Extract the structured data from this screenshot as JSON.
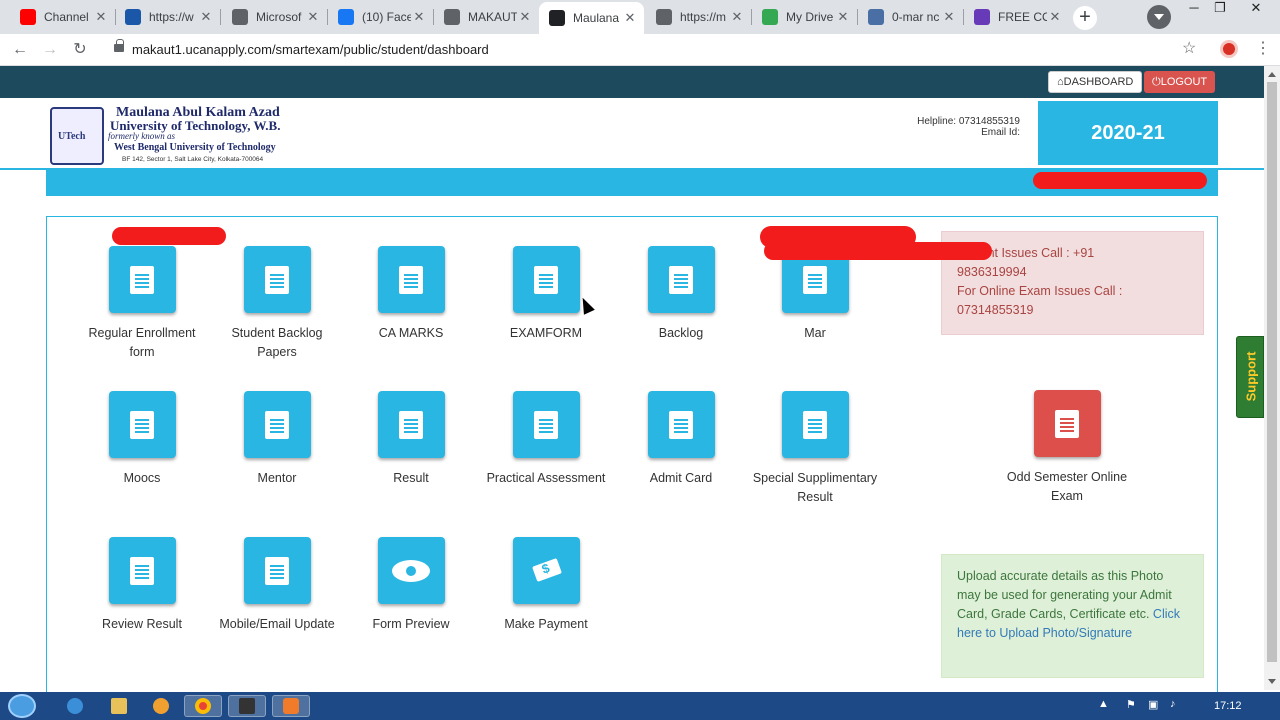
{
  "browser": {
    "tabs": [
      {
        "title": "Channel",
        "favicon": "youtube-icon",
        "color": "#ff0000"
      },
      {
        "title": "https://w",
        "favicon": "nic-icon",
        "color": "#1a57a8"
      },
      {
        "title": "Microsof",
        "favicon": "globe-icon",
        "color": "#5f6368"
      },
      {
        "title": "(10) Face",
        "favicon": "facebook-icon",
        "color": "#1877f2"
      },
      {
        "title": "MAKAUT",
        "favicon": "globe-icon",
        "color": "#5f6368"
      },
      {
        "title": "Maulana",
        "favicon": "graduation-cap-icon",
        "color": "#202124"
      },
      {
        "title": "https://m",
        "favicon": "globe-icon",
        "color": "#5f6368"
      },
      {
        "title": "My Drive",
        "favicon": "google-drive-icon",
        "color": "#34a853"
      },
      {
        "title": "0-mar nc",
        "favicon": "page-icon",
        "color": "#4a6fa5"
      },
      {
        "title": "FREE CO",
        "favicon": "forms-icon",
        "color": "#673ab7"
      }
    ],
    "close_glyph": "✕",
    "new_tab_glyph": "+",
    "url": "makaut1.ucanapply.com/smartexam/public/student/dashboard"
  },
  "page": {
    "dashboard_label": "DASHBOARD",
    "logout_label": "LOGOUT",
    "university": {
      "line1": "Maulana Abul Kalam Azad",
      "line2": "University of Technology, W.B.",
      "line3": "formerly known as",
      "line4": "West Bengal University of Technology",
      "line5": "BF 142, Sector 1, Salt Lake City, Kolkata-700064"
    },
    "helpline": "Helpline: 07314855319",
    "email": "Email Id:",
    "session": "2020-21",
    "tiles_row1": [
      {
        "label": "Regular Enrollment form",
        "icon": "document-icon"
      },
      {
        "label": "Student Backlog Papers",
        "icon": "document-icon"
      },
      {
        "label": "CA MARKS",
        "icon": "document-icon"
      },
      {
        "label": "EXAMFORM",
        "icon": "document-icon"
      },
      {
        "label": "Backlog",
        "icon": "document-icon"
      },
      {
        "label": "Mar",
        "icon": "document-icon"
      }
    ],
    "tiles_row2": [
      {
        "label": "Moocs",
        "icon": "document-icon"
      },
      {
        "label": "Mentor",
        "icon": "document-icon"
      },
      {
        "label": "Result",
        "icon": "document-icon"
      },
      {
        "label": "Practical Assessment",
        "icon": "document-icon"
      },
      {
        "label": "Admit Card",
        "icon": "document-icon"
      },
      {
        "label": "Special Supplimentary Result",
        "icon": "document-icon"
      }
    ],
    "tiles_row3": [
      {
        "label": "Review Result",
        "icon": "document-icon"
      },
      {
        "label": "Mobile/Email Update",
        "icon": "document-icon"
      },
      {
        "label": "Form Preview",
        "icon": "eye-icon"
      },
      {
        "label": "Make Payment",
        "icon": "payment-icon"
      }
    ],
    "odd_semester_tile": {
      "label": "Odd Semester Online Exam",
      "icon": "document-icon",
      "color": "#dc4f4b"
    },
    "alert_pink": {
      "line1": "ayment Issues Call : +91",
      "line2": "9836319994",
      "line3": "For Online Exam Issues Call :",
      "line4": "07314855319"
    },
    "alert_green": {
      "text": "Upload accurate details as this Photo may be used for generating your Admit Card, Grade Cards, Certificate etc.",
      "link": "Click here to Upload Photo/Signature"
    },
    "support_label": "Support",
    "accent_color": "#29b6e3"
  },
  "taskbar": {
    "clock": "17:12"
  }
}
